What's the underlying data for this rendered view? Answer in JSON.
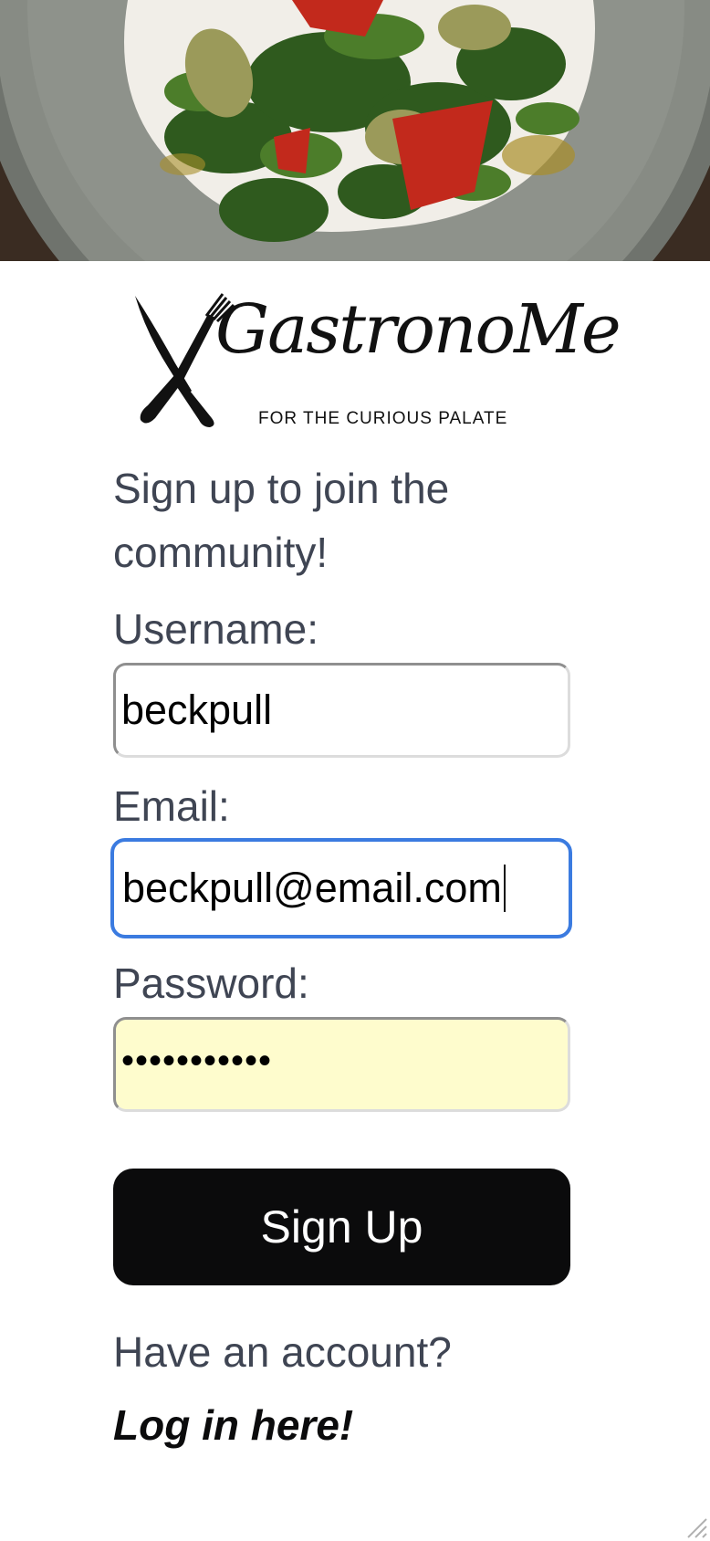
{
  "brand": {
    "name": "GastronoMe",
    "tagline": "FOR THE CURIOUS PALATE"
  },
  "form": {
    "intro": "Sign up to join the community!",
    "username_label": "Username:",
    "username_value": "beckpull",
    "email_label": "Email:",
    "email_value": "beckpull@email.com",
    "password_label": "Password:",
    "password_mask": "•••••••••••",
    "submit_label": "Sign Up"
  },
  "footer": {
    "have_account": "Have an account?",
    "login_link": "Log in here!"
  },
  "colors": {
    "text": "#3f4553",
    "button": "#0b0b0c",
    "focus_ring": "#3b7be0",
    "autofill": "#fefccd"
  }
}
